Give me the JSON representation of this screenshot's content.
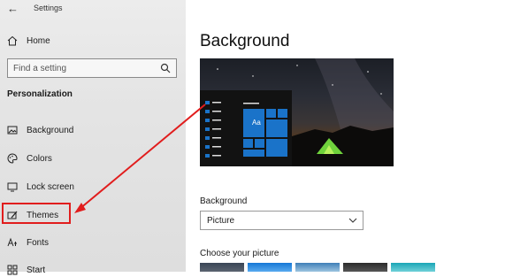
{
  "window": {
    "title": "Settings"
  },
  "sidebar": {
    "home_label": "Home",
    "search_placeholder": "Find a setting",
    "section_title": "Personalization",
    "items": [
      {
        "label": "Background",
        "icon": "picture-icon"
      },
      {
        "label": "Colors",
        "icon": "palette-icon"
      },
      {
        "label": "Lock screen",
        "icon": "monitor-icon"
      },
      {
        "label": "Themes",
        "icon": "brush-icon",
        "highlighted": true
      },
      {
        "label": "Fonts",
        "icon": "font-icon"
      },
      {
        "label": "Start",
        "icon": "start-icon"
      }
    ]
  },
  "main": {
    "page_title": "Background",
    "preview": {
      "tile_text": "Aa",
      "accent": "#1a73c9"
    },
    "background_label": "Background",
    "background_value": "Picture",
    "choose_label": "Choose your picture"
  },
  "annotation": {
    "color": "#e11d1d",
    "target": "Themes"
  }
}
